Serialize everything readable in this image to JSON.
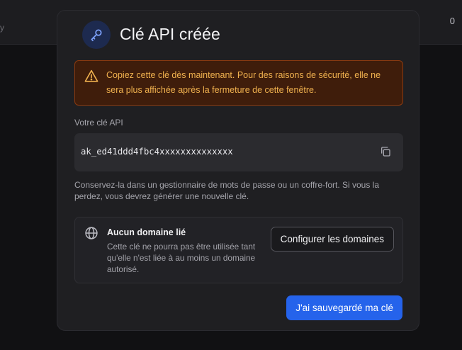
{
  "background": {
    "left_text": "y",
    "count": "0"
  },
  "modal": {
    "title": "Clé API créée",
    "header_icon": "key-icon",
    "warning": {
      "icon": "warning-triangle-icon",
      "text": "Copiez cette clé dès maintenant. Pour des raisons de sécurité, elle ne sera plus affichée après la fermeture de cette fenêtre."
    },
    "key_label": "Votre clé API",
    "key_value": "ak_ed41ddd4fbc4xxxxxxxxxxxxxx",
    "copy_icon": "copy-icon",
    "hint": "Conservez-la dans un gestionnaire de mots de passe ou un coffre-fort. Si vous la perdez, vous devrez générer une nouvelle clé.",
    "domain": {
      "icon": "globe-icon",
      "title": "Aucun domaine lié",
      "description": "Cette clé ne pourra pas être utilisée tant qu'elle n'est liée à au moins un domaine autorisé.",
      "configure_label": "Configurer les domaines"
    },
    "confirm_label": "J'ai sauvegardé ma clé"
  },
  "colors": {
    "accent": "#2563eb",
    "warning_bg": "#3f1d0b",
    "warning_text": "#f1b24f"
  }
}
